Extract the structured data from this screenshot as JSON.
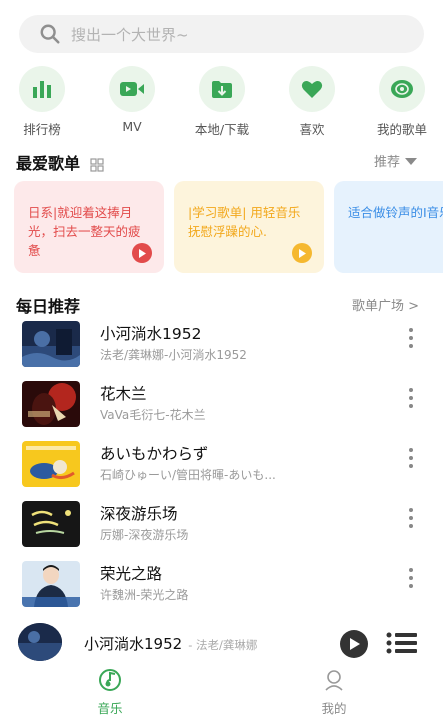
{
  "search": {
    "placeholder": "搜出一个大世界~"
  },
  "quick_entries": [
    {
      "label": "排行榜",
      "icon": "bar-chart-icon"
    },
    {
      "label": "MV",
      "icon": "video-icon"
    },
    {
      "label": "本地/下载",
      "icon": "download-folder-icon"
    },
    {
      "label": "喜欢",
      "icon": "heart-icon"
    },
    {
      "label": "我的歌单",
      "icon": "disc-icon"
    }
  ],
  "favorites": {
    "title": "最爱歌单",
    "sort_label": "推荐",
    "cards": [
      {
        "text": "日系|就迎着这捧月光，扫去一整天的疲惫",
        "bg": "#fde9ea",
        "color": "#e24b4b"
      },
      {
        "text": "|学习歌单| 用轻音乐抚慰浮躁的心.",
        "bg": "#fdf4dc",
        "color": "#f2a81c"
      },
      {
        "text": "适合做铃声的Ⅰ音乐",
        "bg": "#e6f2fd",
        "color": "#3b8ee6"
      }
    ]
  },
  "daily": {
    "title": "每日推荐",
    "more_label": "歌单广场 >",
    "songs": [
      {
        "title": "小河淌水1952",
        "subtitle": "法老/龚琳娜-小河淌水1952"
      },
      {
        "title": "花木兰",
        "subtitle": "VaVa毛衍七-花木兰"
      },
      {
        "title": "あいもかわらず",
        "subtitle": "石崎ひゅーい/管田将暉-あいも..."
      },
      {
        "title": "深夜游乐场",
        "subtitle": "厉娜-深夜游乐场"
      },
      {
        "title": "荣光之路",
        "subtitle": "许魏洲-荣光之路"
      }
    ]
  },
  "player": {
    "title": "小河淌水1952",
    "subtitle": "- 法老/龚琳娜"
  },
  "tabs": [
    {
      "label": "音乐",
      "active": true
    },
    {
      "label": "我的",
      "active": false
    }
  ],
  "colors": {
    "accent": "#3aa757",
    "quick_bg": "#eaf5ea"
  }
}
